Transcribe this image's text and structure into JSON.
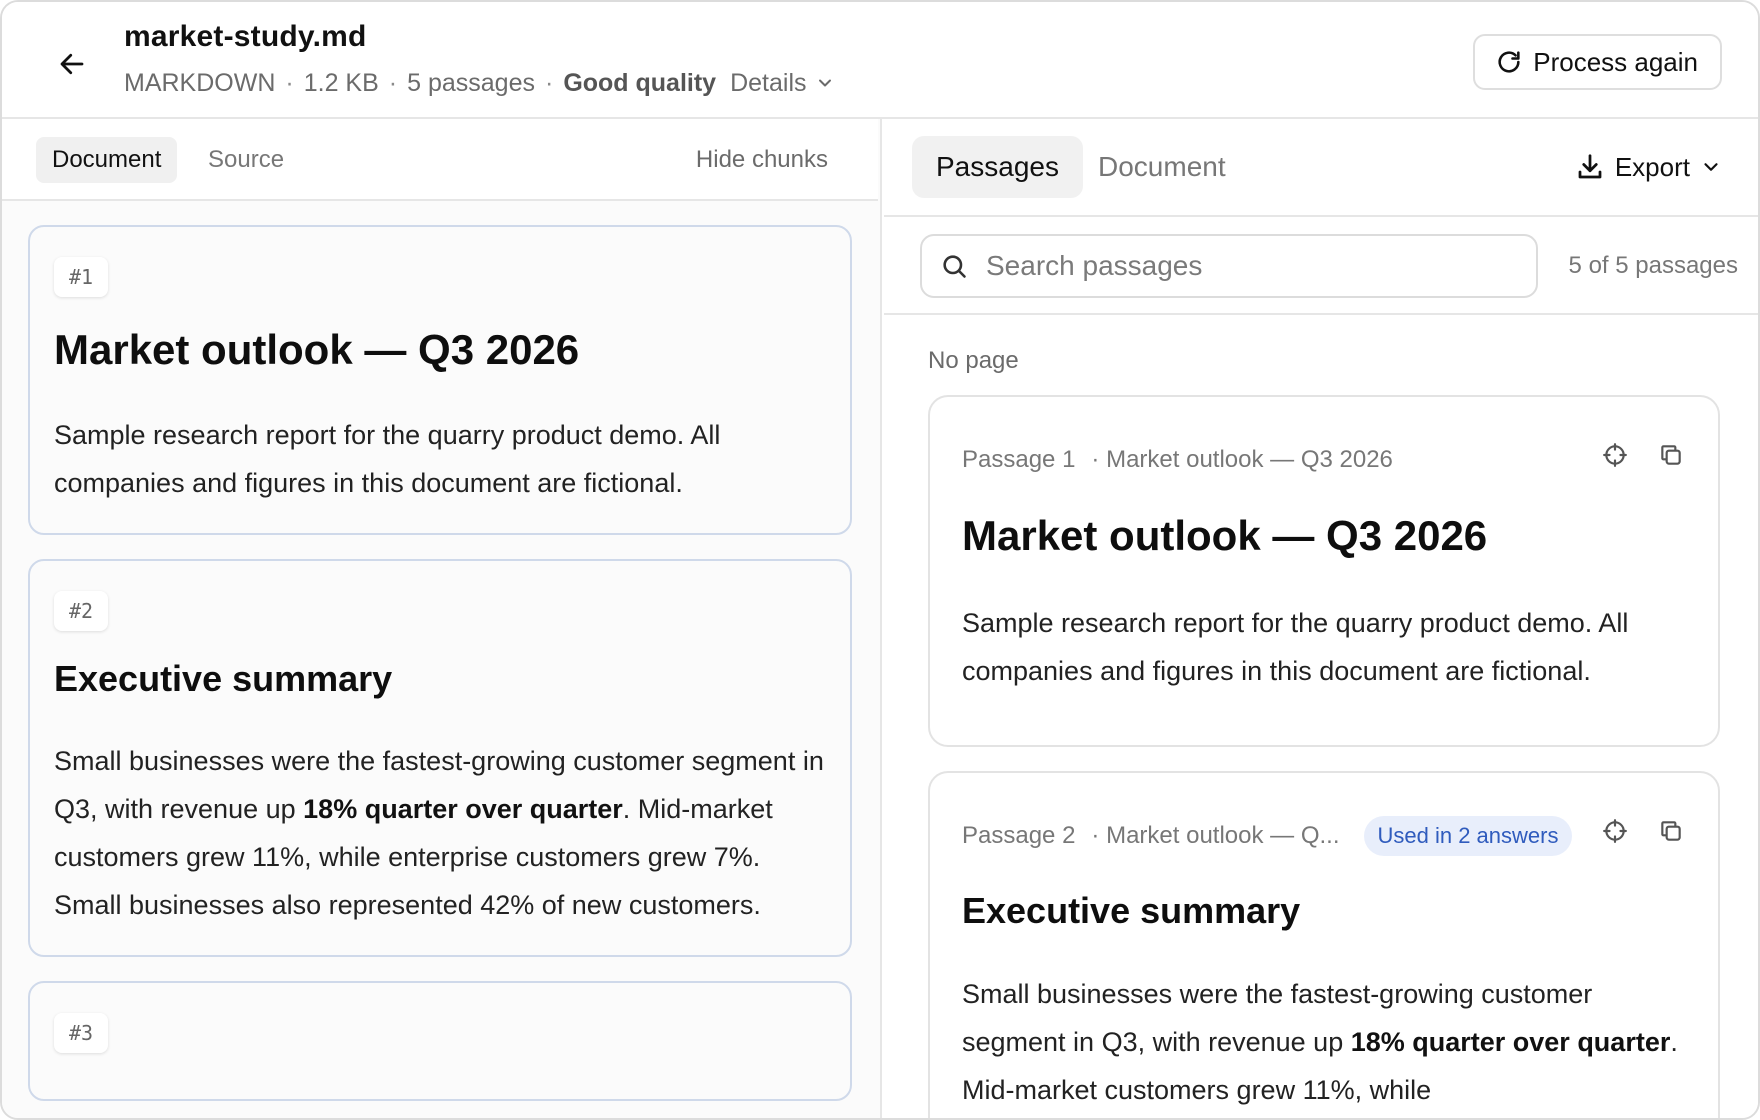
{
  "header": {
    "file_name": "market-study.md",
    "meta": {
      "format": "MARKDOWN",
      "size": "1.2 KB",
      "passages": "5 passages",
      "quality": "Good quality",
      "details_label": "Details"
    },
    "process_again_label": "Process again",
    "icons": {
      "back": "arrow-left-icon",
      "refresh": "refresh-icon",
      "details": "chevron-down-icon"
    }
  },
  "left": {
    "tabs": [
      {
        "label": "Document",
        "active": true
      },
      {
        "label": "Source",
        "active": false
      }
    ],
    "hide_chunks_label": "Hide chunks",
    "chunks": [
      {
        "badge": "#1",
        "heading": "Market outlook — Q3 2026",
        "text": "Sample research report for the quarry product demo. All companies and figures in this document are fictional."
      },
      {
        "badge": "#2",
        "heading": "Executive summary",
        "text_before": "Small businesses were the fastest-growing customer segment in Q3, with revenue up ",
        "text_bold": "18% quarter over quarter",
        "text_after": ". Mid-market customers grew 11%, while enterprise customers grew 7%. Small businesses also represented 42% of new customers."
      },
      {
        "badge": "#3"
      }
    ]
  },
  "right": {
    "tabs": [
      {
        "label": "Passages",
        "active": true
      },
      {
        "label": "Document",
        "active": false
      }
    ],
    "export_label": "Export",
    "search_placeholder": "Search passages",
    "count_label": "5 of 5 passages",
    "group_label": "No page",
    "passages": [
      {
        "label": "Passage 1",
        "section": "· Market outlook — Q3 2026",
        "heading": "Market outlook — Q3 2026",
        "text": "Sample research report for the quarry product demo. All companies and figures in this document are fictional."
      },
      {
        "label": "Passage 2",
        "section": "· Market outlook — Q...",
        "badge": "Used in 2 answers",
        "heading": "Executive summary",
        "text_before": "Small businesses were the fastest-growing customer segment in Q3, with revenue up ",
        "text_bold": "18% quarter over quarter",
        "text_after": ". Mid-market customers grew 11%, while"
      }
    ],
    "icons": {
      "export": "download-icon",
      "search": "search-icon",
      "locate": "crosshair-icon",
      "copy": "copy-icon"
    },
    "badge_color": "#2f5bbd"
  }
}
